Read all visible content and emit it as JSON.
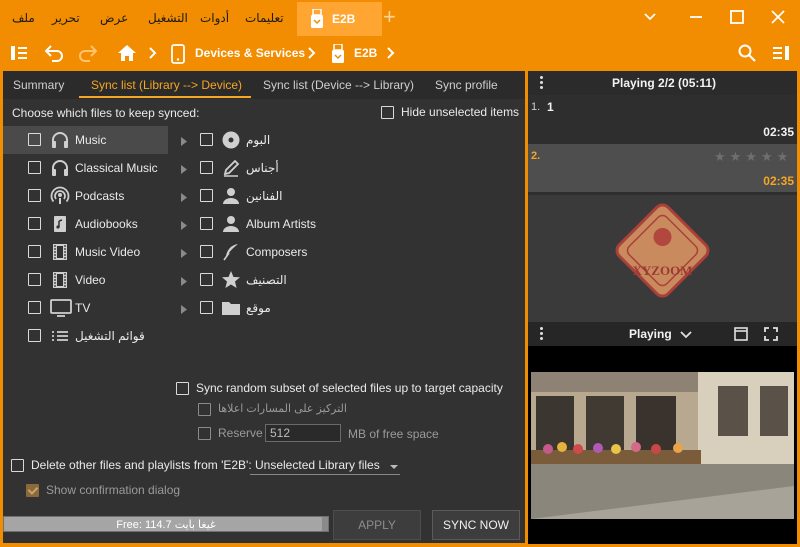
{
  "titlebar": {
    "menus": [
      "ملف",
      "تحرير",
      "عرض",
      "التشغيل",
      "أدوات",
      "تعليمات"
    ],
    "active_tab": "E2B",
    "new_tab_glyph": "+",
    "window_controls": [
      "chevron-down-icon",
      "restore-icon",
      "maximize-icon",
      "close-icon"
    ]
  },
  "nav": {
    "breadcrumbs": [
      "Devices & Services",
      "E2B"
    ]
  },
  "sync": {
    "tabs": [
      "Summary",
      "Sync list (Library --> Device)",
      "Sync list (Device --> Library)",
      "Sync profile"
    ],
    "active_tab_index": 1,
    "choose_label": "Choose which files to keep synced:",
    "hide_unselected_label": "Hide unselected items",
    "left_items": [
      {
        "label": "Music",
        "icon": "headphones-icon",
        "selected": true
      },
      {
        "label": "Classical Music",
        "icon": "headphones-icon"
      },
      {
        "label": "Podcasts",
        "icon": "podcast-icon"
      },
      {
        "label": "Audiobooks",
        "icon": "audiobook-icon"
      },
      {
        "label": "Music Video",
        "icon": "film-icon"
      },
      {
        "label": "Video",
        "icon": "film-icon"
      },
      {
        "label": "TV",
        "icon": "tv-icon"
      },
      {
        "label": "قوائم التشغيل",
        "icon": "playlist-icon"
      }
    ],
    "right_items": [
      {
        "label": "البوم",
        "icon": "disc-icon"
      },
      {
        "label": "أجناس",
        "icon": "pen-icon"
      },
      {
        "label": "الفنانين",
        "icon": "person-icon"
      },
      {
        "label": "Album Artists",
        "icon": "person-icon"
      },
      {
        "label": "Composers",
        "icon": "quill-icon"
      },
      {
        "label": "التصنيف",
        "icon": "star-icon"
      },
      {
        "label": "موقع",
        "icon": "folder-icon"
      }
    ],
    "random_subset_label": "Sync random subset of selected files up to target capacity",
    "focus_label": "التركيز على المسارات اعلاها",
    "reserve_label": "Reserve",
    "reserve_value": "512",
    "reserve_unit": "MB of free space",
    "delete_label": "Delete other files and playlists from 'E2B':",
    "delete_option": "Unselected Library files",
    "confirm_label": "Show confirmation dialog",
    "free_label": "Free: 114.7 غيغا بايت",
    "free_fraction": 0.98,
    "apply_label": "APPLY",
    "sync_label": "SYNC NOW"
  },
  "player": {
    "header": "Playing 2/2 (05:11)",
    "tracks": [
      {
        "num": "1.",
        "title": "1",
        "duration": "02:35"
      },
      {
        "num": "2.",
        "title": "",
        "duration": "02:35",
        "rating": "★★★★★"
      }
    ],
    "art_bar_label": "Playing",
    "logo_text": "XYZOOM"
  },
  "colors": {
    "accent": "#f28c00",
    "highlight": "#f5a623",
    "panel": "#323232"
  }
}
